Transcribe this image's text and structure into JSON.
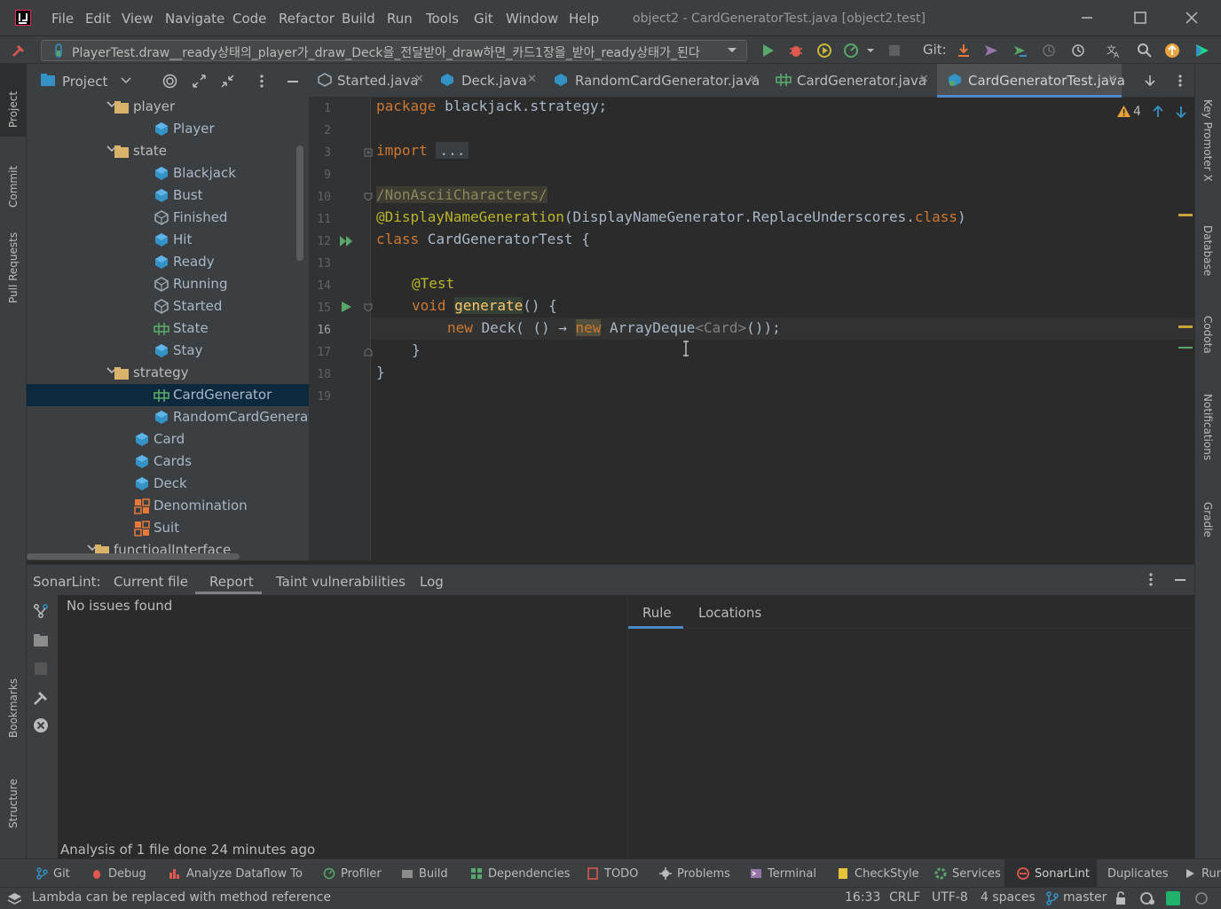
{
  "menu": {
    "items": [
      "File",
      "Edit",
      "View",
      "Navigate",
      "Code",
      "Refactor",
      "Build",
      "Run",
      "Tools",
      "Git",
      "Window",
      "Help"
    ],
    "window_title": "object2 - CardGeneratorTest.java [object2.test]"
  },
  "toolbar": {
    "run_config": "PlayerTest.draw__ready상태의_player가_draw_Deck을_전달받아_draw하면_카드1장을_받아_ready상태가_된다",
    "git_label": "Git:"
  },
  "left_strip": {
    "items": [
      "Project",
      "Commit",
      "Pull Requests",
      "Bookmarks",
      "Structure"
    ]
  },
  "right_strip": {
    "items": [
      "Key Promoter X",
      "Database",
      "Codota",
      "Notifications",
      "Gradle"
    ]
  },
  "project": {
    "title": "Project",
    "tree": [
      {
        "label": "player",
        "kind": "folder",
        "expanded": true
      },
      {
        "label": "Player",
        "kind": "class"
      },
      {
        "label": "state",
        "kind": "folder",
        "expanded": true
      },
      {
        "label": "Blackjack",
        "kind": "class"
      },
      {
        "label": "Bust",
        "kind": "class"
      },
      {
        "label": "Finished",
        "kind": "abstract"
      },
      {
        "label": "Hit",
        "kind": "class"
      },
      {
        "label": "Ready",
        "kind": "class"
      },
      {
        "label": "Running",
        "kind": "abstract"
      },
      {
        "label": "Started",
        "kind": "abstract"
      },
      {
        "label": "State",
        "kind": "interface"
      },
      {
        "label": "Stay",
        "kind": "class"
      },
      {
        "label": "strategy",
        "kind": "folder",
        "expanded": true
      },
      {
        "label": "CardGenerator",
        "kind": "interface",
        "selected": true
      },
      {
        "label": "RandomCardGenerator",
        "kind": "class"
      },
      {
        "label": "Card",
        "kind": "class"
      },
      {
        "label": "Cards",
        "kind": "class"
      },
      {
        "label": "Deck",
        "kind": "class"
      },
      {
        "label": "Denomination",
        "kind": "enum"
      },
      {
        "label": "Suit",
        "kind": "enum"
      },
      {
        "label": "functioalInterface",
        "kind": "folder",
        "expanded": true
      }
    ]
  },
  "editor": {
    "tabs": [
      {
        "label": "Started.java",
        "active": false
      },
      {
        "label": "Deck.java",
        "active": false
      },
      {
        "label": "RandomCardGenerator.java",
        "active": false
      },
      {
        "label": "CardGenerator.java",
        "active": false
      },
      {
        "label": "CardGeneratorTest.java",
        "active": true
      }
    ],
    "warnings_count": "4",
    "line_numbers": [
      "1",
      "2",
      "3",
      "9",
      "10",
      "11",
      "12",
      "13",
      "14",
      "15",
      "16",
      "17",
      "18",
      "19"
    ],
    "current_line": "16",
    "code": {
      "l1_kw": "package",
      "l1_rest": " blackjack.strategy;",
      "l3_kw": "import",
      "l3_fold": "...",
      "l10": "/NonAsciiCharacters/",
      "l11_ann": "@DisplayNameGeneration",
      "l11_a": "(DisplayNameGenerator.ReplaceUnderscores.",
      "l11_cls": "class",
      "l11_b": ")",
      "l12_kw": "class",
      "l12_rest": " CardGeneratorTest {",
      "l14_ann": "@Test",
      "l15_kw": "void",
      "l15_fn": "generate",
      "l15_rest": "() {",
      "l16_kw1": "new",
      "l16_a": " Deck( () → ",
      "l16_kw2": "new",
      "l16_b": " ArrayDeque",
      "l16_gen": "<Card>",
      "l16_c": "());",
      "l17": "}",
      "l18": "}"
    }
  },
  "sonar": {
    "prefix": "SonarLint:",
    "tabs": [
      "Current file",
      "Report",
      "Taint vulnerabilities",
      "Log"
    ],
    "active_tab": "Report",
    "no_issues": "No issues found",
    "analysis": "Analysis of 1 file done 24 minutes ago",
    "right_tabs": [
      "Rule",
      "Locations"
    ]
  },
  "bottom_tools": [
    "Git",
    "Debug",
    "Analyze Dataflow To",
    "Profiler",
    "Build",
    "Dependencies",
    "TODO",
    "Problems",
    "Terminal",
    "CheckStyle",
    "Services",
    "SonarLint",
    "Duplicates",
    "Run"
  ],
  "status": {
    "message": "Lambda can be replaced with method reference",
    "position": "16:33",
    "line_sep": "CRLF",
    "encoding": "UTF-8",
    "indent": "4 spaces",
    "branch": "master"
  },
  "colors": {
    "accent": "#4a88c7",
    "selection": "#0d293e",
    "keyword": "#cc7832",
    "annotation": "#bbb529",
    "function": "#ffc66d"
  }
}
